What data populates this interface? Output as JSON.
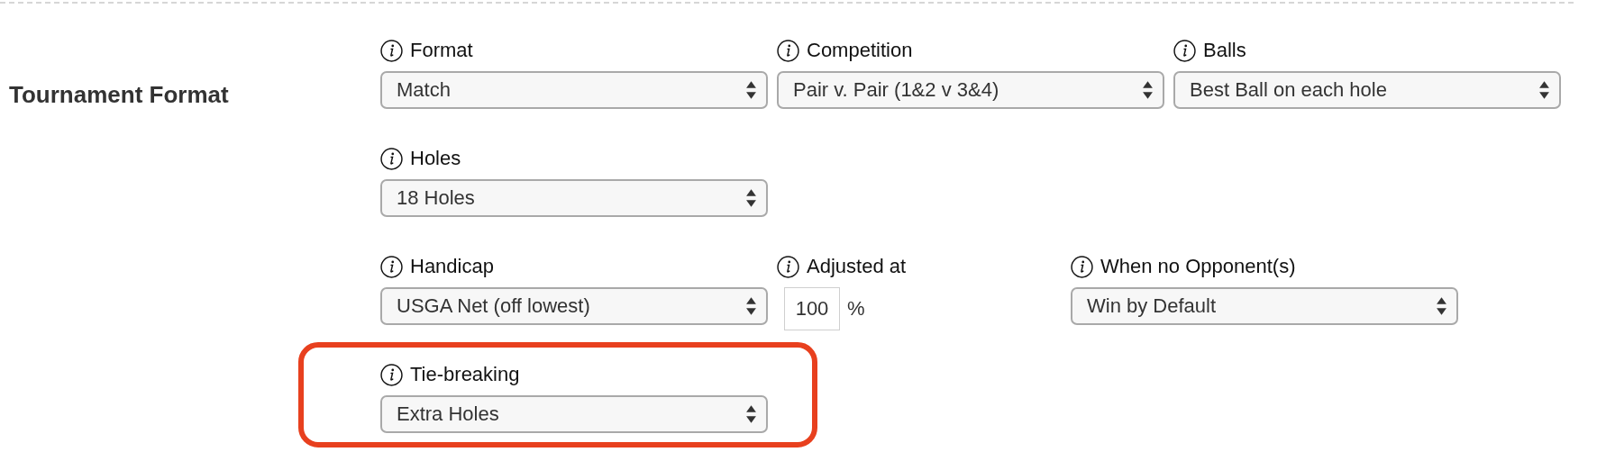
{
  "section": {
    "title": "Tournament Format"
  },
  "rows": [
    {
      "fields": [
        {
          "kind": "select",
          "label": "Format",
          "value": "Match",
          "highlighted": false
        },
        {
          "kind": "select",
          "label": "Competition",
          "value": "Pair v. Pair (1&2 v 3&4)",
          "highlighted": false
        },
        {
          "kind": "select",
          "label": "Balls",
          "value": "Best Ball on each hole",
          "highlighted": false
        }
      ]
    },
    {
      "fields": [
        {
          "kind": "select",
          "label": "Holes",
          "value": "18 Holes",
          "highlighted": false
        }
      ]
    },
    {
      "fields": [
        {
          "kind": "select",
          "label": "Handicap",
          "value": "USGA Net (off lowest)",
          "highlighted": false
        },
        {
          "kind": "number",
          "label": "Adjusted at",
          "value": "100",
          "unit": "%",
          "highlighted": false
        },
        {
          "kind": "select",
          "label": "When no Opponent(s)",
          "value": "Win by Default",
          "highlighted": false
        }
      ]
    },
    {
      "fields": [
        {
          "kind": "select",
          "label": "Tie-breaking",
          "value": "Extra Holes",
          "highlighted": true
        }
      ]
    }
  ]
}
